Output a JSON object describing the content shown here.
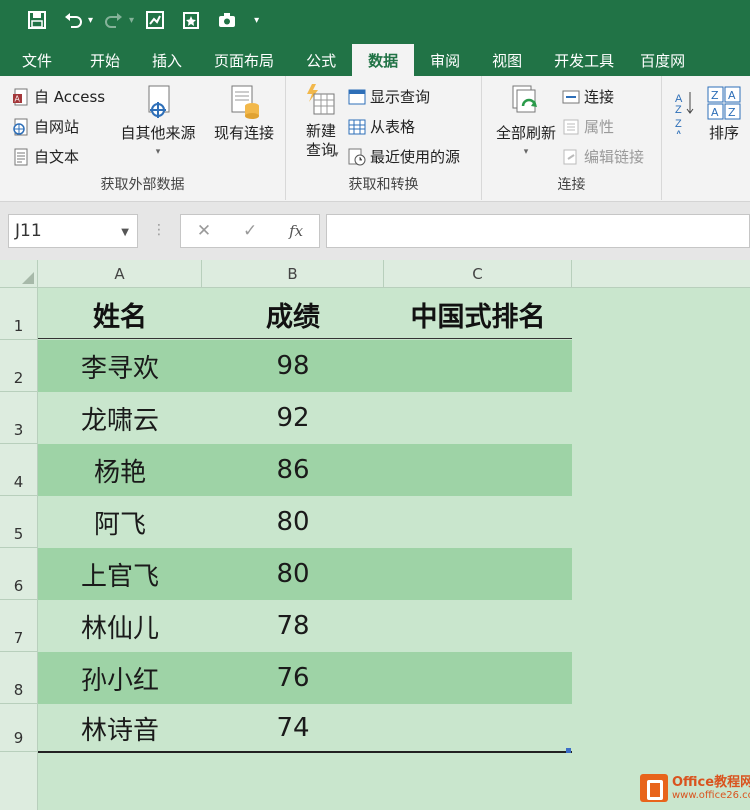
{
  "qat": {
    "icons": [
      "save-icon",
      "undo-icon",
      "redo-icon",
      "form-icon",
      "bookmark-icon",
      "camera-icon",
      "customize-icon"
    ]
  },
  "tabs": [
    "文件",
    "开始",
    "插入",
    "页面布局",
    "公式",
    "数据",
    "审阅",
    "视图",
    "开发工具",
    "百度网"
  ],
  "active_tab": "数据",
  "ribbon": {
    "get_external": {
      "access": "自 Access",
      "web": "自网站",
      "text": "自文本",
      "other_sources": "自其他来源",
      "existing": "现有连接",
      "label": "获取外部数据"
    },
    "get_transform": {
      "new_query_line1": "新建",
      "new_query_line2": "查询",
      "show_queries": "显示查询",
      "from_table": "从表格",
      "recent_sources": "最近使用的源",
      "label": "获取和转换"
    },
    "connections": {
      "refresh_all": "全部刷新",
      "connections": "连接",
      "properties": "属性",
      "edit_links": "编辑链接",
      "label": "连接"
    },
    "sort": {
      "sort": "排序"
    }
  },
  "formula_bar": {
    "name_box": "J11",
    "cancel": "✕",
    "enter": "✓",
    "fx": "fx",
    "formula": ""
  },
  "sheet": {
    "columns": [
      "A",
      "B",
      "C"
    ],
    "rows": [
      "1",
      "2",
      "3",
      "4",
      "5",
      "6",
      "7",
      "8",
      "9"
    ],
    "headers": [
      "姓名",
      "成绩",
      "中国式排名"
    ],
    "data": [
      {
        "name": "李寻欢",
        "score": "98"
      },
      {
        "name": "龙啸云",
        "score": "92"
      },
      {
        "name": "杨艳",
        "score": "86"
      },
      {
        "name": "阿飞",
        "score": "80"
      },
      {
        "name": "上官飞",
        "score": "80"
      },
      {
        "name": "林仙儿",
        "score": "78"
      },
      {
        "name": "孙小红",
        "score": "76"
      },
      {
        "name": "林诗音",
        "score": "74"
      }
    ]
  },
  "watermark": {
    "brand": "Office教程网",
    "url": "www.office26.com"
  }
}
